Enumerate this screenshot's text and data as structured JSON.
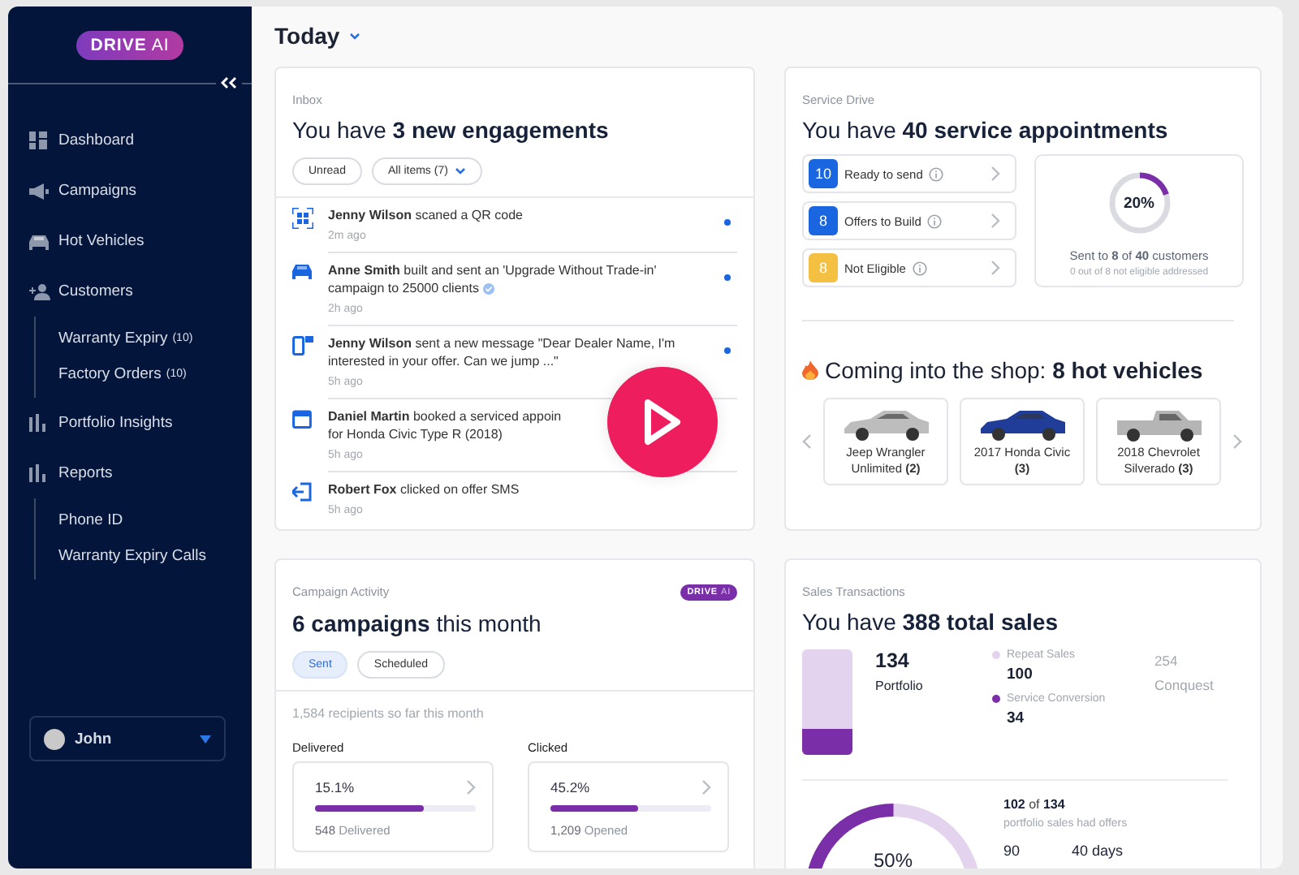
{
  "sidebar": {
    "logo": {
      "word": "DRIVE",
      "suffix": "AI"
    },
    "items": [
      {
        "label": "Dashboard",
        "kind": "grid"
      },
      {
        "label": "Campaigns",
        "kind": "megaphone"
      },
      {
        "label": "Hot Vehicles",
        "kind": "car"
      },
      {
        "label": "Customers",
        "kind": "people",
        "children": [
          {
            "label": "Warranty Expiry",
            "count": "(10)"
          },
          {
            "label": "Factory Orders",
            "count": "(10)"
          }
        ]
      },
      {
        "label": "Portfolio Insights",
        "kind": "bars"
      },
      {
        "label": "Reports",
        "kind": "bars",
        "children": [
          {
            "label": "Phone ID"
          },
          {
            "label": "Warranty Expiry Calls"
          }
        ]
      }
    ],
    "user": {
      "name": "John"
    }
  },
  "header": {
    "title": "Today"
  },
  "inbox": {
    "label": "Inbox",
    "heading": "You have **3 new engagements**",
    "filters": [
      {
        "label": "Unread",
        "kind": "plain"
      },
      {
        "label": "All items (7)",
        "kind": "dropdown"
      }
    ],
    "items": [
      {
        "kind": "qr",
        "text": "**Jenny Wilson** scaned a QR code",
        "time": "2m ago",
        "unread": true,
        "verified": false
      },
      {
        "kind": "car",
        "text": "**Anne Smith** built and sent an 'Upgrade Without Trade-in' campaign to 25000 clients",
        "time": "2h ago",
        "unread": true,
        "verified": true
      },
      {
        "kind": "phone",
        "text": "**Jenny Wilson** sent a new message \"Dear Dealer Name, I'm interested in your offer. Can we jump ...\"",
        "time": "5h ago",
        "unread": true,
        "verified": false
      },
      {
        "kind": "calendar",
        "text": "**Daniel Martin** booked a serviced appoin",
        "text2": "for Honda Civic Type R (2018)",
        "time": "5h ago",
        "unread": false,
        "verified": false
      },
      {
        "kind": "exit",
        "text": "**Robert Fox** clicked on offer SMS",
        "time": "5h ago",
        "unread": false,
        "verified": false
      }
    ]
  },
  "service": {
    "label": "Service Drive",
    "heading": "You have **40 service appointments**",
    "statuses": [
      {
        "count": "10",
        "label": "Ready to send",
        "color": "#1a66e0"
      },
      {
        "count": "8",
        "label": "Offers to Build",
        "color": "#1a66e0"
      },
      {
        "count": "8",
        "label": "Not Eligible",
        "color": "#f4c042"
      }
    ],
    "progress": {
      "level": 0.2,
      "reading": "20%",
      "sent": "Sent to **8** of **40** customers",
      "note": "0 out of 8 not eligible addressed"
    },
    "hot_heading": "Coming into the shop: **8 hot vehicles**",
    "vehicles": [
      {
        "name": "Jeep Wrangler Unlimited **(2)**",
        "kind": "sedan",
        "color": "#bdbdbd"
      },
      {
        "name": "2017 Honda Civic **(3)**",
        "kind": "sedan",
        "color": "#1f3d99"
      },
      {
        "name": "2018 Chevrolet Silverado **(3)**",
        "kind": "pickup",
        "color": "#b5b5b5"
      }
    ]
  },
  "campaign": {
    "label": "Campaign Activity",
    "badge": {
      "word": "DRIVE",
      "suffix": "AI"
    },
    "heading": "**6 campaigns** this month",
    "tabs": [
      {
        "label": "Sent",
        "selected": true
      },
      {
        "label": "Scheduled",
        "selected": false
      }
    ],
    "summary": "1,584 recipients so far this month",
    "metrics": [
      {
        "title": "Delivered",
        "value": "15.1%",
        "level": 0.68,
        "caption": "**548** Delivered"
      },
      {
        "title": "Clicked",
        "value": "45.2%",
        "level": 0.55,
        "caption": "**1,209** Opened"
      }
    ]
  },
  "sales": {
    "label": "Sales Transactions",
    "heading": "You have **388 total sales**",
    "bar": {
      "level": 0.25
    },
    "portfolio": {
      "value": "134",
      "label": "Portfolio"
    },
    "legend": [
      {
        "label": "Repeat Sales",
        "value": "100",
        "color": "#e3d3ee"
      },
      {
        "label": "Service Conversion",
        "value": "34",
        "color": "#7a2fa8"
      }
    ],
    "conquest": {
      "value": "254",
      "label": "Conquest"
    },
    "offers": {
      "reading": "50%",
      "line": "**102** of **134**",
      "caption": "portfolio sales had offers",
      "stats": [
        "90",
        "40 days"
      ]
    }
  }
}
